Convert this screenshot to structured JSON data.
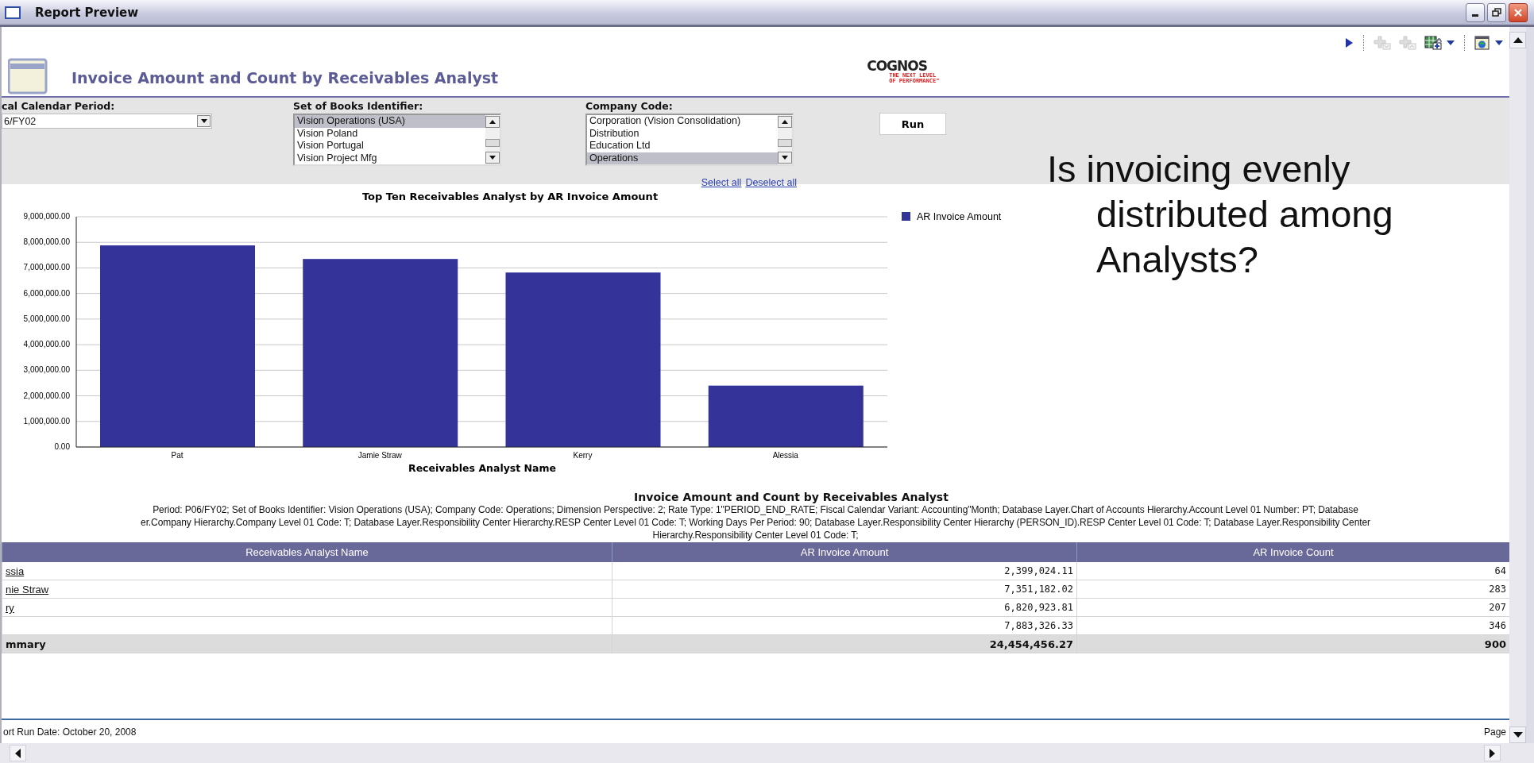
{
  "window": {
    "title": "Report Preview"
  },
  "toolbar": [
    {
      "kind": "run",
      "disabled": false,
      "dropdown": false
    },
    {
      "kind": "add-below",
      "disabled": true,
      "dropdown": false
    },
    {
      "kind": "add-above",
      "disabled": true,
      "dropdown": false
    },
    {
      "kind": "export",
      "disabled": false,
      "dropdown": true
    },
    {
      "kind": "view",
      "disabled": false,
      "dropdown": true
    }
  ],
  "report": {
    "title": "Invoice Amount and Count by Receivables Analyst",
    "logo": {
      "name": "COGNOS",
      "tagline_1": "THE NEXT LEVEL",
      "tagline_2": "OF PERFORMANCE™"
    }
  },
  "prompts": [
    {
      "kind": "dropdown",
      "label": "cal Calendar Period:",
      "value": "6/FY02"
    },
    {
      "kind": "listbox",
      "label": "Set of Books Identifier:",
      "options": [
        {
          "label": "Vision Operations (USA)",
          "selected": true
        },
        {
          "label": "Vision Poland",
          "selected": false
        },
        {
          "label": "Vision Portugal",
          "selected": false
        },
        {
          "label": "Vision Project Mfg",
          "selected": false
        }
      ]
    },
    {
      "kind": "listbox",
      "label": "Company Code:",
      "options": [
        {
          "label": "Corporation (Vision Consolidation)",
          "selected": false
        },
        {
          "label": "Distribution",
          "selected": false
        },
        {
          "label": "Education Ltd",
          "selected": false
        },
        {
          "label": "Operations",
          "selected": true
        }
      ]
    }
  ],
  "run_button": "Run",
  "links": [
    "Select all",
    "Deselect all"
  ],
  "chart": {
    "chart_data": {
      "type": "bar",
      "title": "Top Ten Receivables Analyst by AR Invoice Amount",
      "xlabel": "Receivables Analyst Name",
      "categories": [
        "Pat",
        "Jamie Straw",
        "Kerry",
        "Alessia"
      ],
      "series": [
        {
          "name": "AR Invoice Amount",
          "color": "#333399",
          "values": [
            7880000,
            7350000,
            6820000,
            2400000
          ]
        }
      ],
      "grid": true,
      "ylim": [
        0,
        9000000
      ],
      "yticks": [
        {
          "value": 0,
          "label": "0.00"
        },
        {
          "value": 1000000,
          "label": "1,000,000.00"
        },
        {
          "value": 2000000,
          "label": "2,000,000.00"
        },
        {
          "value": 3000000,
          "label": "3,000,000.00"
        },
        {
          "value": 4000000,
          "label": "4,000,000.00"
        },
        {
          "value": 5000000,
          "label": "5,000,000.00"
        },
        {
          "value": 6000000,
          "label": "6,000,000.00"
        },
        {
          "value": 7000000,
          "label": "7,000,000.00"
        },
        {
          "value": 8000000,
          "label": "8,000,000.00"
        },
        {
          "value": 9000000,
          "label": "9,000,000.00"
        }
      ]
    }
  },
  "question": "Is invoicing evenly distributed among Analysts?",
  "table": {
    "title": "Invoice Amount and Count by Receivables Analyst",
    "filter_lines": [
      "Period: P06/FY02; Set of Books Identifier: Vision Operations (USA); Company Code: Operations; Dimension Perspective: 2; Rate Type: 1\"PERIOD_END_RATE; Fiscal Calendar Variant: Accounting\"Month; Database Layer.Chart of Accounts Hierarchy.Account Level 01 Number: PT; Database",
      "er.Company Hierarchy.Company Level 01 Code: T; Database Layer.Responsibility Center Hierarchy.RESP Center Level 01 Code: T; Working Days Per Period: 90; Database Layer.Responsibility Center Hierarchy (PERSON_ID).RESP Center Level 01 Code: T; Database Layer.Responsibility Center",
      "Hierarchy.Responsibility Center Level 01 Code: T;"
    ],
    "columns": [
      "Receivables Analyst Name",
      "AR Invoice Amount",
      "AR Invoice Count"
    ],
    "rows": [
      {
        "name": "ssia",
        "amount": "2,399,024.11",
        "count": "64"
      },
      {
        "name": "nie Straw",
        "amount": "7,351,182.02",
        "count": "283"
      },
      {
        "name": "ry",
        "amount": "6,820,923.81",
        "count": "207"
      },
      {
        "amount": "7,883,326.33",
        "count": "346"
      }
    ],
    "summary": {
      "label": "mmary",
      "amount": "24,454,456.27",
      "count": "900"
    }
  },
  "footer": {
    "run_date": "ort Run Date: October 20, 2008",
    "page": "Page"
  }
}
